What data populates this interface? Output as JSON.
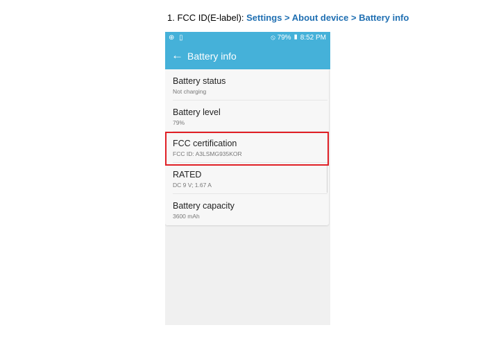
{
  "caption": {
    "prefix": "1. FCC ID(E-label): ",
    "path": "Settings > About device > Battery info"
  },
  "statusbar": {
    "left_icons": "⊕ ▯",
    "right": "⦸ 79% ▮ 8:52 PM"
  },
  "appbar": {
    "back_icon": "←",
    "title": "Battery info"
  },
  "items": [
    {
      "title": "Battery status",
      "subtitle": "Not charging"
    },
    {
      "title": "Battery level",
      "subtitle": "79%"
    },
    {
      "title": "FCC certification",
      "subtitle": "FCC ID: A3LSMG935KOR"
    },
    {
      "title": "RATED",
      "subtitle": "DC 9 V; 1.67 A"
    },
    {
      "title": "Battery capacity",
      "subtitle": "3600 mAh"
    }
  ],
  "colors": {
    "accent": "#45b1d9",
    "highlight": "#e01f25",
    "caption_path": "#1f6fb2"
  }
}
